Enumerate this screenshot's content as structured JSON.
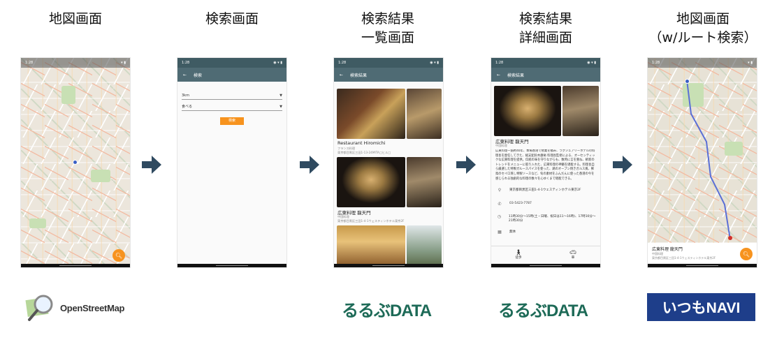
{
  "screens": [
    {
      "title": "地図画面"
    },
    {
      "title": "検索画面"
    },
    {
      "title_line1": "検索結果",
      "title_line2": "一覧画面"
    },
    {
      "title_line1": "検索結果",
      "title_line2": "詳細画面"
    },
    {
      "title_line1": "地図画面",
      "title_line2": "（w/ルート検索）"
    }
  ],
  "search": {
    "appbar_title": "検索",
    "distance_value": "3km",
    "category_value": "食べる",
    "button_label": "検索"
  },
  "results": {
    "appbar_title": "検索結果",
    "items": [
      {
        "name": "Restaurant Hiromichi",
        "category": "フランス料理",
        "address": "東京都目黒区三田1-13-24MITA□ヒル□"
      },
      {
        "name": "広東料理 龍天門",
        "category": "中国料理",
        "address": "東京都目黒区三田1-4-1ウェスティンホテル東京2F"
      }
    ]
  },
  "detail": {
    "appbar_title": "検索結果",
    "name": "広東料理 龍天門",
    "category": "中国料理",
    "description": "広東料理一筋約40年、本場香港で修業を積み、ラグジュアリーホテルの料理長を歴任してきた、総支配鈴木康裕 料理長監修による、オーセンティックな広東料理を提供。伝統の味を守りながらも、数時に言を重ね、斬新のトレンドをメニューに取り入れた、広東料理の神髄を堪能する。料理長自ら厳選した特製ガルースパイスを使った、鶏のオーブン焼きガルス風、鮮鳥のセイロ蒸し特製ソースなど、旬の素材をふんだんに使った香港の今を感じられる独創的な料理の数々を心ゆくまで堪能できる。",
    "address": "東京都目黒区三田1-4-1ウェスティンホテル東京2F",
    "phone": "03-5423-7787",
    "hours": "11時30分〜15時(土・日曜、祝日は11〜16時)、17時30分〜21時30分",
    "holiday": "無休",
    "walk_label": "徒歩",
    "car_label": "車"
  },
  "route_map": {
    "name": "広東料理 龍天門",
    "category": "中国料理",
    "address": "東京都目黒区三田1-4-1ウェスティンホテル東京2F"
  },
  "status_time": "1:28",
  "logos": {
    "osm": "OpenStreetMap",
    "rurubu": "るるぶDATA",
    "itsumo": "いつもNAVI"
  },
  "colors": {
    "appbar": "#4f6b74",
    "statusbar": "#3f5b63",
    "accent": "#f7931e",
    "rurubu_green": "#1d6a57",
    "itsumo_navy": "#1e3e8a"
  },
  "icons": [
    "back-arrow-icon",
    "search-icon",
    "dropdown-caret-icon",
    "location-pin-icon",
    "phone-icon",
    "clock-icon",
    "calendar-icon",
    "walk-icon",
    "car-icon",
    "flow-arrow-icon",
    "magnifier-map-icon"
  ]
}
